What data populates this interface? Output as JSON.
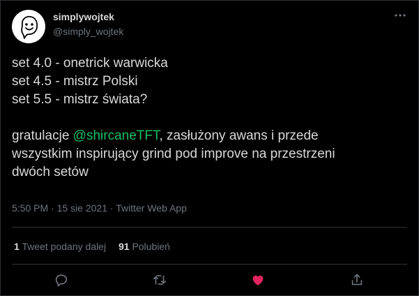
{
  "author": {
    "name": "simplywojtek",
    "handle": "@simply_wojtek"
  },
  "tweet": {
    "lines": [
      "set 4.0 - onetrick warwicka",
      "set 4.5 - mistrz Polski",
      "set 5.5 - mistrz świata?"
    ],
    "para_prefix": "gratulacje ",
    "mention": "@shircaneTFT",
    "para_rest_1": ", zasłużony awans i przede",
    "para_line_2": "wszystkim inspirujący grind pod improve na przestrzeni",
    "para_line_3": "dwóch setów"
  },
  "meta": {
    "time": "5:50 PM",
    "date": "15 sie 2021",
    "source": "Twitter Web App",
    "separator": "·"
  },
  "stats": {
    "retweets_count": "1",
    "retweets_label": "Tweet podany dalej",
    "likes_count": "91",
    "likes_label": "Polubień"
  },
  "colors": {
    "background": "#000000",
    "text": "#d9d9d9",
    "muted": "#6e767d",
    "mention": "#17bf63",
    "like": "#e0245e",
    "divider": "#2f3336"
  },
  "icons": {
    "more": "more-icon",
    "reply": "reply-icon",
    "retweet": "retweet-icon",
    "like": "heart-icon",
    "share": "share-icon"
  }
}
